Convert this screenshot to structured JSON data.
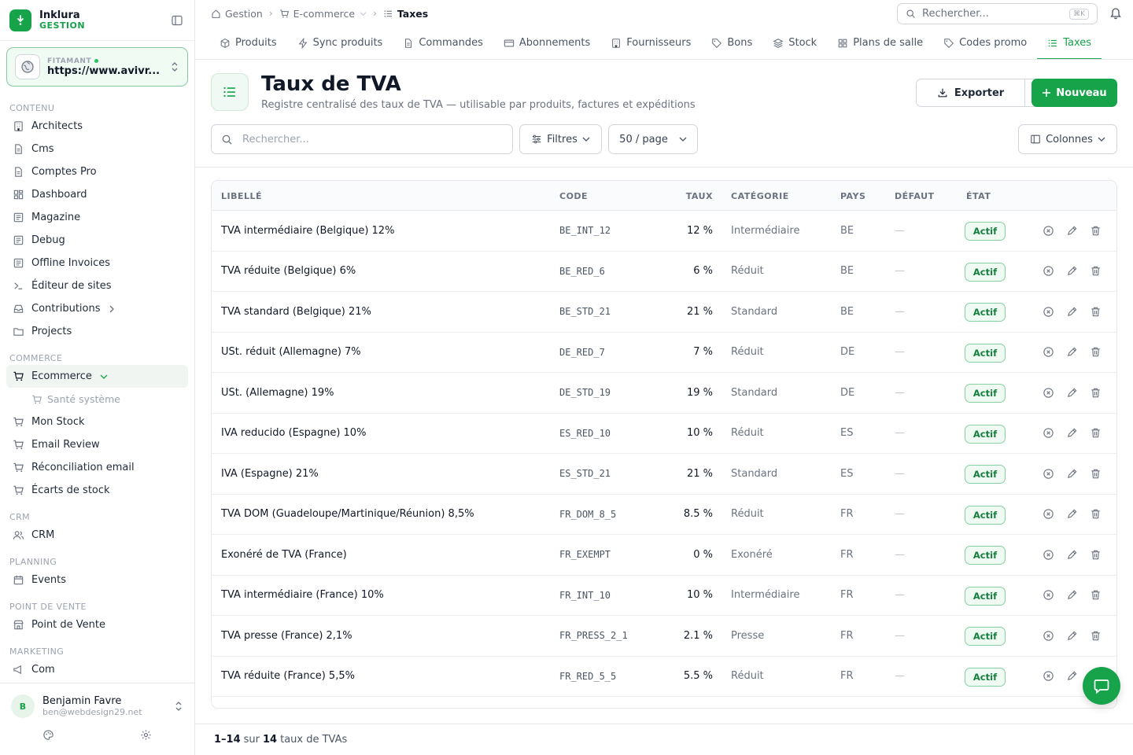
{
  "app": {
    "name": "Inklura",
    "subtitle": "GESTION"
  },
  "workspace": {
    "label": "FITAMANT",
    "url": "https://www.avivr..."
  },
  "sidebar": {
    "sections": [
      {
        "title": "CONTENU",
        "items": [
          "Architects",
          "Cms",
          "Comptes Pro",
          "Dashboard",
          "Magazine",
          "Debug",
          "Offline Invoices",
          "Éditeur de sites",
          "Contributions",
          "Projects"
        ]
      },
      {
        "title": "COMMERCE",
        "items": [
          "Ecommerce",
          "Santé système",
          "Mon Stock",
          "Email Review",
          "Réconciliation email",
          "Écarts de stock"
        ]
      },
      {
        "title": "CRM",
        "items": [
          "CRM"
        ]
      },
      {
        "title": "PLANNING",
        "items": [
          "Events"
        ]
      },
      {
        "title": "POINT DE VENTE",
        "items": [
          "Point de Vente"
        ]
      },
      {
        "title": "MARKETING",
        "items": [
          "Com"
        ]
      }
    ]
  },
  "user": {
    "initial": "B",
    "name": "Benjamin Favre",
    "email": "ben@webdesign29.net"
  },
  "breadcrumb": [
    "Gestion",
    "E-commerce",
    "Taxes"
  ],
  "global_search": {
    "placeholder": "Rechercher...",
    "shortcut": "⌘K"
  },
  "tabs": [
    "Produits",
    "Sync produits",
    "Commandes",
    "Abonnements",
    "Fournisseurs",
    "Bons",
    "Stock",
    "Plans de salle",
    "Codes promo",
    "Taxes"
  ],
  "page": {
    "title": "Taux de TVA",
    "subtitle": "Registre centralisé des taux de TVA — utilisable par produits, factures et expéditions",
    "export_label": "Exporter",
    "new_label": "Nouveau",
    "search_placeholder": "Rechercher...",
    "filters_label": "Filtres",
    "per_page_label": "50 / page",
    "columns_label": "Colonnes"
  },
  "table": {
    "headers": [
      "LIBELLÉ",
      "CODE",
      "TAUX",
      "CATÉGORIE",
      "PAYS",
      "DÉFAUT",
      "ÉTAT"
    ],
    "rows": [
      {
        "label": "TVA intermédiaire (Belgique) 12%",
        "code": "BE_INT_12",
        "rate": "12 %",
        "category": "Intermédiaire",
        "country": "BE",
        "default": "—",
        "status": "Actif"
      },
      {
        "label": "TVA réduite (Belgique) 6%",
        "code": "BE_RED_6",
        "rate": "6 %",
        "category": "Réduit",
        "country": "BE",
        "default": "—",
        "status": "Actif"
      },
      {
        "label": "TVA standard (Belgique) 21%",
        "code": "BE_STD_21",
        "rate": "21 %",
        "category": "Standard",
        "country": "BE",
        "default": "—",
        "status": "Actif"
      },
      {
        "label": "USt. réduit (Allemagne) 7%",
        "code": "DE_RED_7",
        "rate": "7 %",
        "category": "Réduit",
        "country": "DE",
        "default": "—",
        "status": "Actif"
      },
      {
        "label": "USt. (Allemagne) 19%",
        "code": "DE_STD_19",
        "rate": "19 %",
        "category": "Standard",
        "country": "DE",
        "default": "—",
        "status": "Actif"
      },
      {
        "label": "IVA reducido (Espagne) 10%",
        "code": "ES_RED_10",
        "rate": "10 %",
        "category": "Réduit",
        "country": "ES",
        "default": "—",
        "status": "Actif"
      },
      {
        "label": "IVA (Espagne) 21%",
        "code": "ES_STD_21",
        "rate": "21 %",
        "category": "Standard",
        "country": "ES",
        "default": "—",
        "status": "Actif"
      },
      {
        "label": "TVA DOM (Guadeloupe/Martinique/Réunion) 8,5%",
        "code": "FR_DOM_8_5",
        "rate": "8.5 %",
        "category": "Réduit",
        "country": "FR",
        "default": "—",
        "status": "Actif"
      },
      {
        "label": "Exonéré de TVA (France)",
        "code": "FR_EXEMPT",
        "rate": "0 %",
        "category": "Exonéré",
        "country": "FR",
        "default": "—",
        "status": "Actif"
      },
      {
        "label": "TVA intermédiaire (France) 10%",
        "code": "FR_INT_10",
        "rate": "10 %",
        "category": "Intermédiaire",
        "country": "FR",
        "default": "—",
        "status": "Actif"
      },
      {
        "label": "TVA presse (France) 2,1%",
        "code": "FR_PRESS_2_1",
        "rate": "2.1 %",
        "category": "Presse",
        "country": "FR",
        "default": "—",
        "status": "Actif"
      },
      {
        "label": "TVA réduite (France) 5,5%",
        "code": "FR_RED_5_5",
        "rate": "5.5 %",
        "category": "Réduit",
        "country": "FR",
        "default": "—",
        "status": "Actif"
      }
    ]
  },
  "pagination": {
    "range": "1–14",
    "sur": "sur",
    "total": "14",
    "suffix": "taux de TVAs"
  },
  "colors": {
    "accent": "#16a34a",
    "badge_bg": "#effaf2",
    "badge_border": "#86d19f"
  }
}
